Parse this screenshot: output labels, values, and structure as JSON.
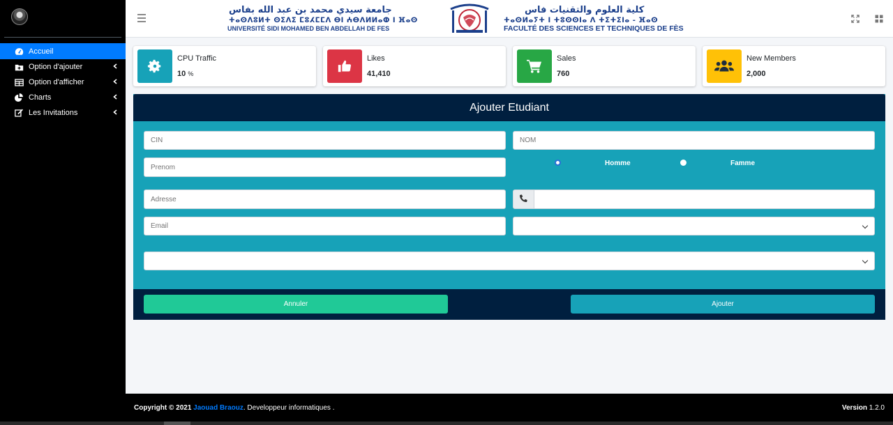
{
  "sidebar": {
    "items": [
      {
        "label": "Accueil",
        "icon": "tachometer-icon",
        "active": true
      },
      {
        "label": "Option d'ajouter",
        "icon": "folder-plus-icon"
      },
      {
        "label": "Option d'afficher",
        "icon": "table-icon"
      },
      {
        "label": "Charts",
        "icon": "pie-chart-icon"
      },
      {
        "label": "Les Invitations",
        "icon": "edit-icon"
      }
    ]
  },
  "header": {
    "logo": {
      "university_ar": "جامعة سيدي محمد بن عبد الله بفاس",
      "university_tz": "ⵜⴰⵙⴷⵓⵍⵜ ⵙⵉⴷⵉ ⵎⵓⵃⵎⵎⴷ ⴱⵏ ⵄⴱⴷⵍⵍⴰⵀ ⵏ ⴼⴰⵙ",
      "university_fr": "UNIVERSITÉ SIDI MOHAMED BEN ABDELLAH DE FES",
      "faculty_ar": "كلية العلوم والتقنيات فاس",
      "faculty_tz": "ⵜⴰⵙⵍⴰⵢⵜ ⵏ ⵜⵓⵙⵙⵏⴰ ⴷ ⵜⵉⵜⵉⵏⴰ - ⴼⴰⵙ",
      "faculty_fr": "FACULTÉ DES SCIENCES ET TECHNIQUES DE FÈS"
    }
  },
  "info_boxes": [
    {
      "label": "CPU Traffic",
      "value": "10",
      "unit": "%",
      "color": "#17a2b8",
      "icon": "gear-icon"
    },
    {
      "label": "Likes",
      "value": "41,410",
      "unit": "",
      "color": "#dc3545",
      "icon": "thumbs-up-icon"
    },
    {
      "label": "Sales",
      "value": "760",
      "unit": "",
      "color": "#28a745",
      "icon": "cart-icon"
    },
    {
      "label": "New Members",
      "value": "2,000",
      "unit": "",
      "color": "#ffc107",
      "icon": "users-icon"
    }
  ],
  "form": {
    "title": "Ajouter Etudiant",
    "cin_placeholder": "CIN",
    "nom_placeholder": "NOM",
    "prenom_placeholder": "Prenom",
    "gender_options": [
      "Homme",
      "Famme"
    ],
    "adresse_placeholder": "Adresse",
    "phone_placeholder": "",
    "email_placeholder": "Email",
    "select1_value": "",
    "select2_value": "",
    "cancel_label": "Annuler",
    "submit_label": "Ajouter"
  },
  "footer": {
    "copyright": "Copyright © 2021",
    "author": "Jaouad Braouz",
    "tagline": ". Developpeur informatiques .",
    "version_label": "Version",
    "version": "1.2.0"
  }
}
